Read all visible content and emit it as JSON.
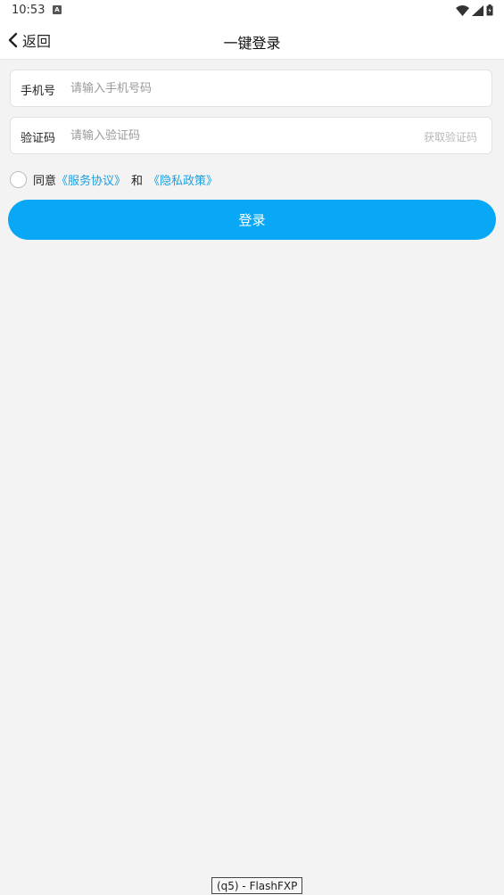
{
  "status_bar": {
    "time": "10:53",
    "notification_icon": "a-letter-icon",
    "icons": [
      "wifi-icon",
      "cell-signal-icon",
      "battery-icon"
    ]
  },
  "header": {
    "back_label": "返回",
    "title": "一键登录"
  },
  "phone_field": {
    "label": "手机号",
    "value": "",
    "placeholder": "请输入手机号码"
  },
  "code_field": {
    "label": "验证码",
    "value": "",
    "placeholder": "请输入验证码",
    "get_code_label": "获取验证码"
  },
  "agreement": {
    "checked": false,
    "prefix": "同意",
    "service_link": "《服务协议》",
    "and": "和",
    "privacy_link": "《隐私政策》"
  },
  "login_button": {
    "label": "登录"
  },
  "bottom_tag": {
    "text": "(q5) - FlashFXP"
  },
  "colors": {
    "accent": "#08a8f7",
    "link": "#1a9fe0",
    "background": "#f3f3f3"
  }
}
